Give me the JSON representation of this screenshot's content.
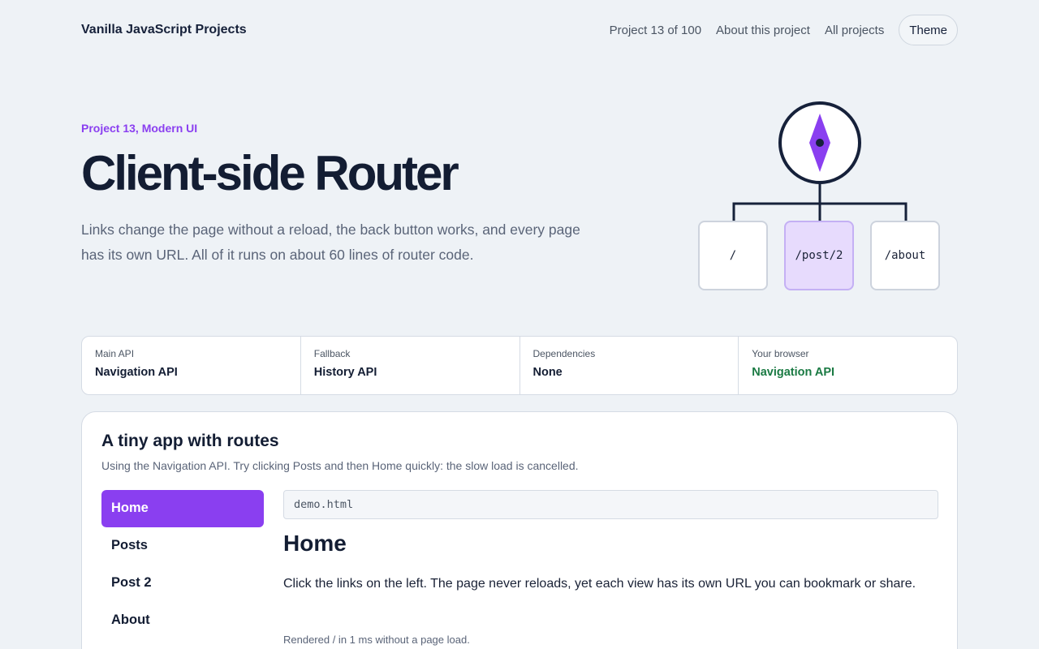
{
  "header": {
    "brand": "Vanilla JavaScript Projects",
    "nav": {
      "counter": "Project 13 of 100",
      "about": "About this project",
      "all": "All projects",
      "theme": "Theme"
    }
  },
  "hero": {
    "eyebrow": "Project 13, Modern UI",
    "title": "Client-side Router",
    "subtitle": "Links change the page without a reload, the back button works, and every page has its own URL. All of it runs on about 60 lines of router code.",
    "routes": [
      "/",
      "/post/2",
      "/about"
    ],
    "active_route": "/post/2",
    "icon": "compass-icon"
  },
  "stats": [
    {
      "label": "Main API",
      "value": "Navigation API"
    },
    {
      "label": "Fallback",
      "value": "History API"
    },
    {
      "label": "Dependencies",
      "value": "None"
    },
    {
      "label": "Your browser",
      "value": "Navigation API"
    }
  ],
  "demo": {
    "title": "A tiny app with routes",
    "subtitle": "Using the Navigation API. Try clicking Posts and then Home quickly: the slow load is cancelled.",
    "nav": [
      "Home",
      "Posts",
      "Post 2",
      "About"
    ],
    "active": "Home",
    "url": "demo.html",
    "view_title": "Home",
    "view_text": "Click the links on the left. The page never reloads, yet each view has its own URL you can bookmark or share.",
    "render_note": "Rendered / in 1 ms without a page load."
  },
  "colors": {
    "accent": "#8a3ff0",
    "accent_light": "#e7dbfd",
    "success": "#1a7a43",
    "background": "#eef2f6"
  }
}
